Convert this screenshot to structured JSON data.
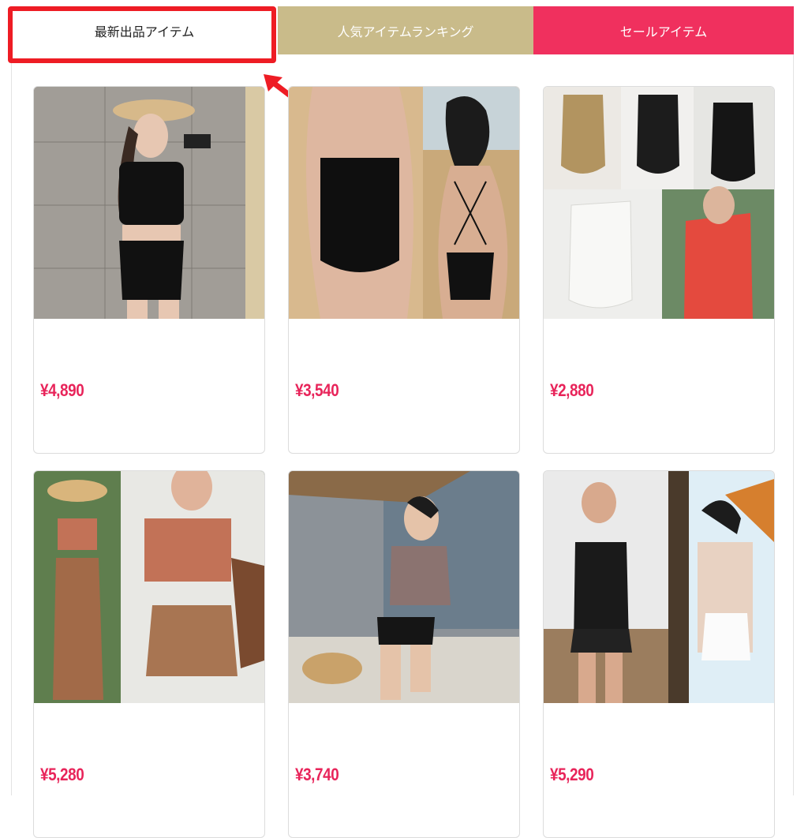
{
  "tabs": {
    "new_items": "最新出品アイテム",
    "ranking": "人気アイテムランキング",
    "sale": "セールアイテム"
  },
  "colors": {
    "ranking_tab": "#c9bb8a",
    "sale_tab": "#f0305e",
    "price": "#e8245a",
    "highlight": "#ee1c24"
  },
  "products": [
    {
      "price": "¥4,890",
      "image": "black-crop-top-high-waist-bikini-photo"
    },
    {
      "price": "¥3,540",
      "image": "black-lace-up-one-piece-swimsuit-photo"
    },
    {
      "price": "¥2,880",
      "image": "one-shoulder-bow-one-piece-swimsuit-photo"
    },
    {
      "price": "¥5,280",
      "image": "terracotta-halter-bikini-with-print-skirt-photo"
    },
    {
      "price": "¥3,740",
      "image": "mauve-crop-top-black-bottom-bikini-photo"
    },
    {
      "price": "¥5,290",
      "image": "black-ruffle-one-piece-swimsuit-photo"
    }
  ]
}
